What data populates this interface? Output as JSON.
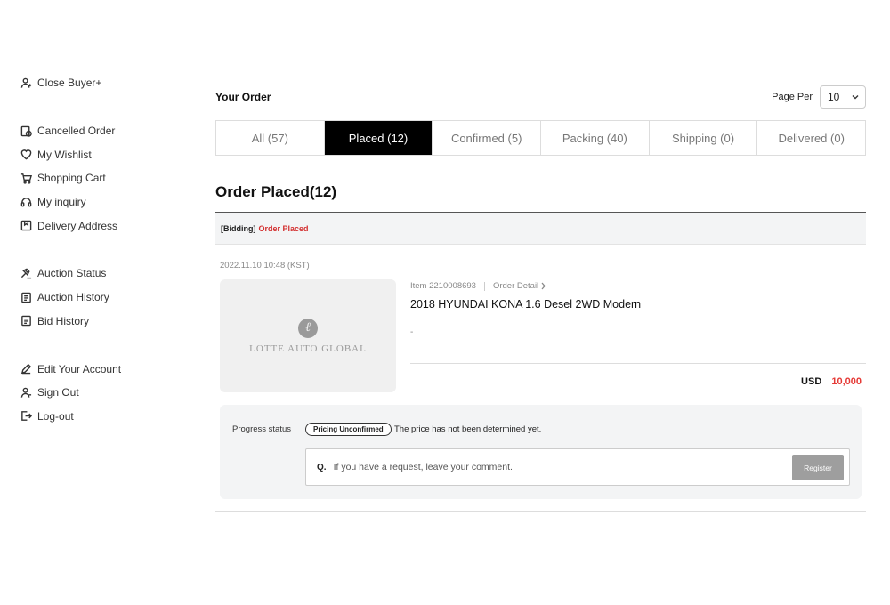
{
  "sidebar": {
    "groups": [
      [
        {
          "label": "Close Buyer+",
          "icon": "user-icon"
        }
      ],
      [
        {
          "label": "Cancelled Order",
          "icon": "cancelled-order-icon"
        },
        {
          "label": "My Wishlist",
          "icon": "heart-icon"
        },
        {
          "label": "Shopping Cart",
          "icon": "cart-icon"
        },
        {
          "label": "My inquiry",
          "icon": "headset-icon"
        },
        {
          "label": "Delivery Address",
          "icon": "address-icon"
        }
      ],
      [
        {
          "label": "Auction Status",
          "icon": "gavel-icon"
        },
        {
          "label": "Auction History",
          "icon": "document-icon"
        },
        {
          "label": "Bid History",
          "icon": "document-icon"
        }
      ],
      [
        {
          "label": "Edit Your Account",
          "icon": "pencil-icon"
        },
        {
          "label": "Sign Out",
          "icon": "user-out-icon"
        },
        {
          "label": "Log-out",
          "icon": "logout-icon"
        }
      ]
    ]
  },
  "header": {
    "title": "Your Order",
    "page_per_label": "Page Per",
    "page_per_value": "10"
  },
  "tabs": [
    {
      "label": "All (57)",
      "active": false
    },
    {
      "label": "Placed (12)",
      "active": true
    },
    {
      "label": "Confirmed (5)",
      "active": false
    },
    {
      "label": "Packing (40)",
      "active": false
    },
    {
      "label": "Shipping (0)",
      "active": false
    },
    {
      "label": "Delivered (0)",
      "active": false
    }
  ],
  "section_title": "Order Placed(12)",
  "order": {
    "type": "[Bidding]",
    "status": "Order Placed",
    "date": "2022.11.10 10:48 (KST)",
    "logo_mark": "ℓ",
    "logo_text": "LOTTE AUTO GLOBAL",
    "item_no": "Item 2210008693",
    "detail_link": "Order Detail",
    "title": "2018 HYUNDAI KONA 1.6 Desel 2WD Modern",
    "sub": "-",
    "currency": "USD",
    "amount": "10,000",
    "progress_label": "Progress status",
    "progress_badge": "Pricing Unconfirmed",
    "progress_message": "The price has not been determined yet.",
    "comment_prefix": "Q.",
    "comment_placeholder": "If you have a request, leave your comment.",
    "register_label": "Register"
  }
}
